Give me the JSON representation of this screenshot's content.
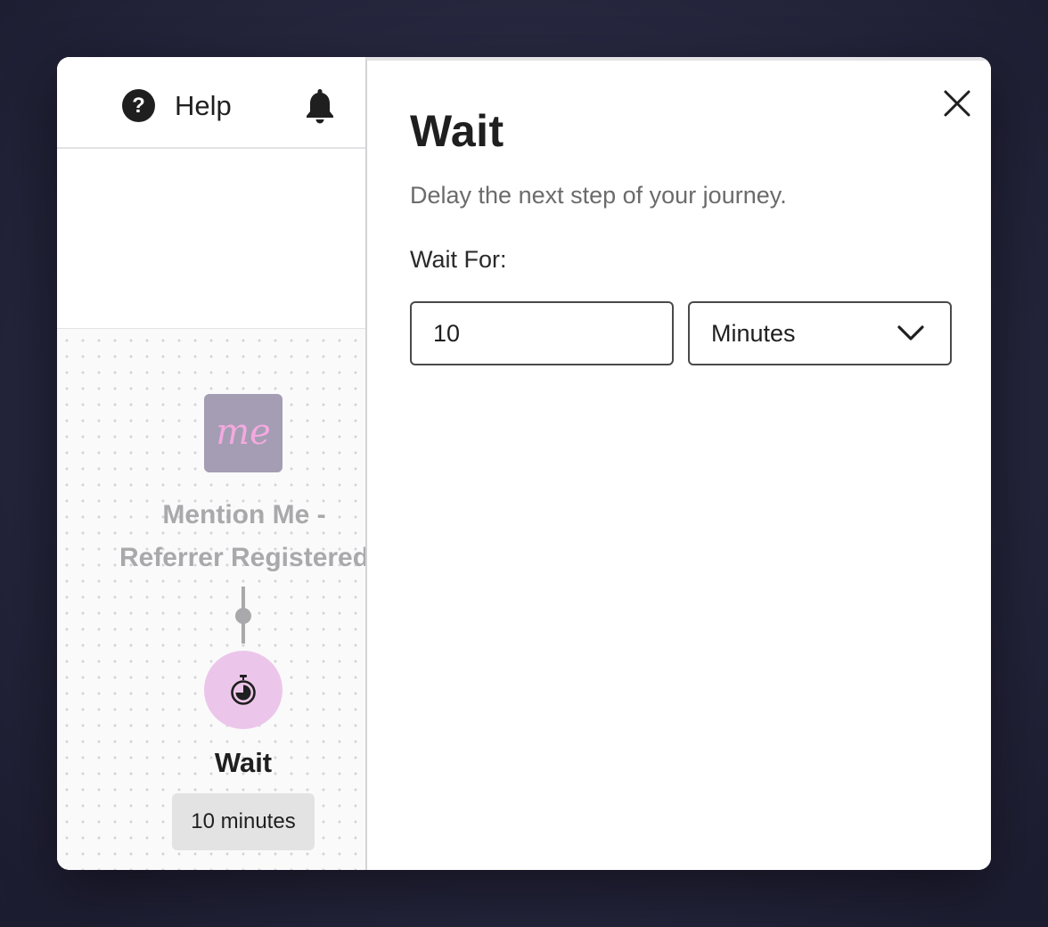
{
  "header": {
    "help_label": "Help",
    "help_icon_glyph": "?"
  },
  "canvas": {
    "trigger_node": {
      "logo_text": "me",
      "title": "Mention Me - Referrer Registered"
    },
    "wait_node": {
      "title": "Wait",
      "badge": "10 minutes"
    }
  },
  "panel": {
    "title": "Wait",
    "subtitle": "Delay the next step of your journey.",
    "field_label": "Wait For:",
    "duration_value": "10",
    "unit_selected": "Minutes"
  },
  "colors": {
    "accent_pink": "#ecc6ea",
    "logo_bg": "#a49db3",
    "logo_text": "#f3a9df"
  },
  "icons": [
    "help-icon",
    "bell-icon",
    "stopwatch-icon",
    "close-icon",
    "chevron-down-icon"
  ]
}
